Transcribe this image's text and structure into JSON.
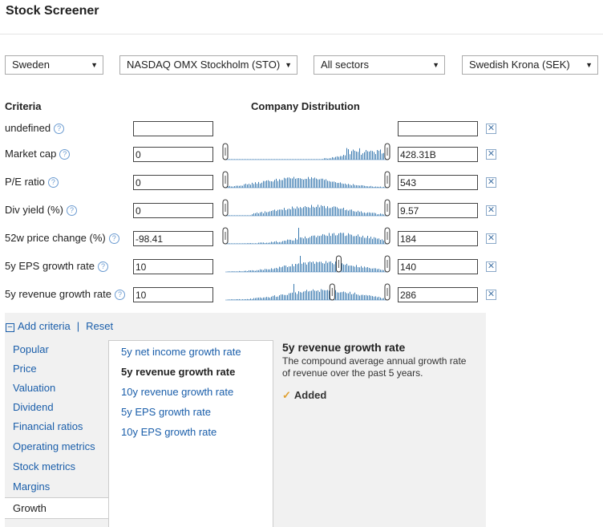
{
  "title": "Stock Screener",
  "filters": {
    "region": "Sweden",
    "exchange": "NASDAQ OMX Stockholm (STO)",
    "sector": "All sectors",
    "currency": "Swedish Krona (SEK)"
  },
  "headers": {
    "criteria": "Criteria",
    "distribution": "Company Distribution"
  },
  "rows": [
    {
      "label": "undefined",
      "min": "",
      "max": "",
      "has_dist": false
    },
    {
      "label": "Market cap",
      "min": "0",
      "max": "428.31B",
      "has_dist": true
    },
    {
      "label": "P/E ratio",
      "min": "0",
      "max": "543",
      "has_dist": true
    },
    {
      "label": "Div yield (%)",
      "min": "0",
      "max": "9.57",
      "has_dist": true
    },
    {
      "label": "52w price change (%)",
      "min": "-98.41",
      "max": "184",
      "has_dist": true
    },
    {
      "label": "5y EPS growth rate",
      "min": "10",
      "max": "140",
      "has_dist": true
    },
    {
      "label": "5y revenue growth rate",
      "min": "10",
      "max": "286",
      "has_dist": true
    }
  ],
  "actions": {
    "add_criteria": "Add criteria",
    "separator": "|",
    "reset": "Reset"
  },
  "categories": [
    "Popular",
    "Price",
    "Valuation",
    "Dividend",
    "Financial ratios",
    "Operating metrics",
    "Stock metrics",
    "Margins",
    "Growth"
  ],
  "selected_category": "Growth",
  "sub_criteria": [
    "5y net income growth rate",
    "5y revenue growth rate",
    "10y revenue growth rate",
    "5y EPS growth rate",
    "10y EPS growth rate"
  ],
  "selected_sub": "5y revenue growth rate",
  "description": {
    "title": "5y revenue growth rate",
    "text": "The compound average annual growth rate of revenue over the past 5 years.",
    "status": "Added"
  },
  "icons": {
    "help": "help-circle-icon",
    "remove": "remove-x-icon",
    "dropdown": "dropdown-arrow-icon",
    "collapse": "minus-square-icon",
    "check": "checkmark-icon"
  },
  "colors": {
    "link": "#1a5eaa",
    "bars": "#3a7ab0",
    "panel": "#f1f1f1"
  }
}
